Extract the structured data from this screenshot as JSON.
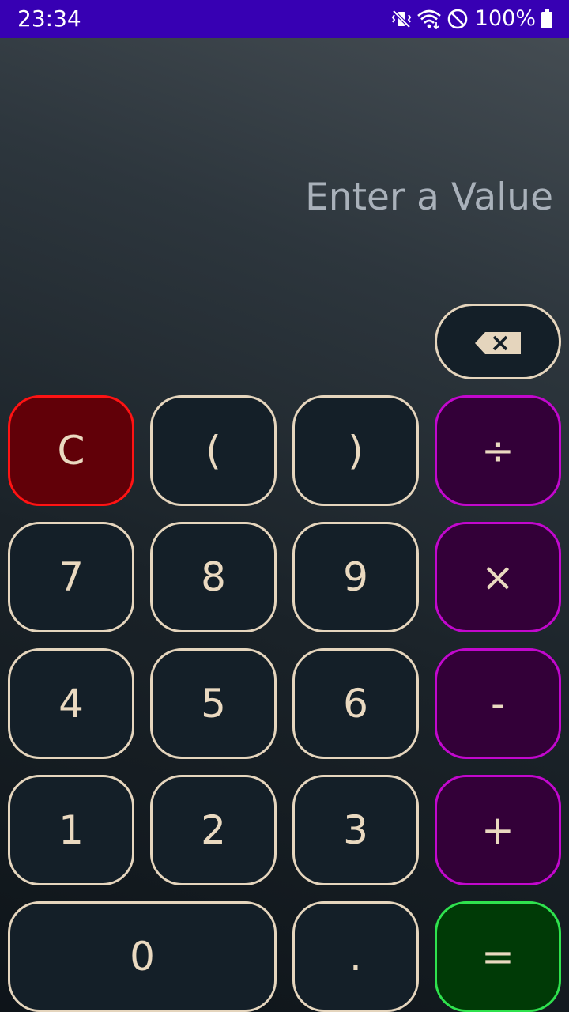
{
  "status_bar": {
    "time": "23:34",
    "battery": "100%",
    "icons": [
      "vibrate-mute-icon",
      "wifi-icon",
      "do-not-disturb-icon",
      "battery-icon"
    ]
  },
  "display": {
    "placeholder": "Enter a Value"
  },
  "keypad": {
    "backspace_icon": "backspace-icon",
    "clear": "C",
    "paren_open": "(",
    "paren_close": ")",
    "divide": "÷",
    "seven": "7",
    "eight": "8",
    "nine": "9",
    "multiply": "×",
    "four": "4",
    "five": "5",
    "six": "6",
    "minus": "-",
    "one": "1",
    "two": "2",
    "three": "3",
    "plus": "+",
    "zero": "0",
    "decimal": ".",
    "equals": "="
  },
  "colors": {
    "status_bar": "#3700b3",
    "key_fill": "#141f28",
    "key_border": "#e5d5bd",
    "key_text": "#ead9c0",
    "clear_fill": "#610008",
    "clear_border": "#ff1313",
    "operator_fill": "#330038",
    "operator_border": "#c208cd",
    "equals_fill": "#003a06",
    "equals_border": "#2fe24e",
    "placeholder_text": "#a9b1ba"
  }
}
